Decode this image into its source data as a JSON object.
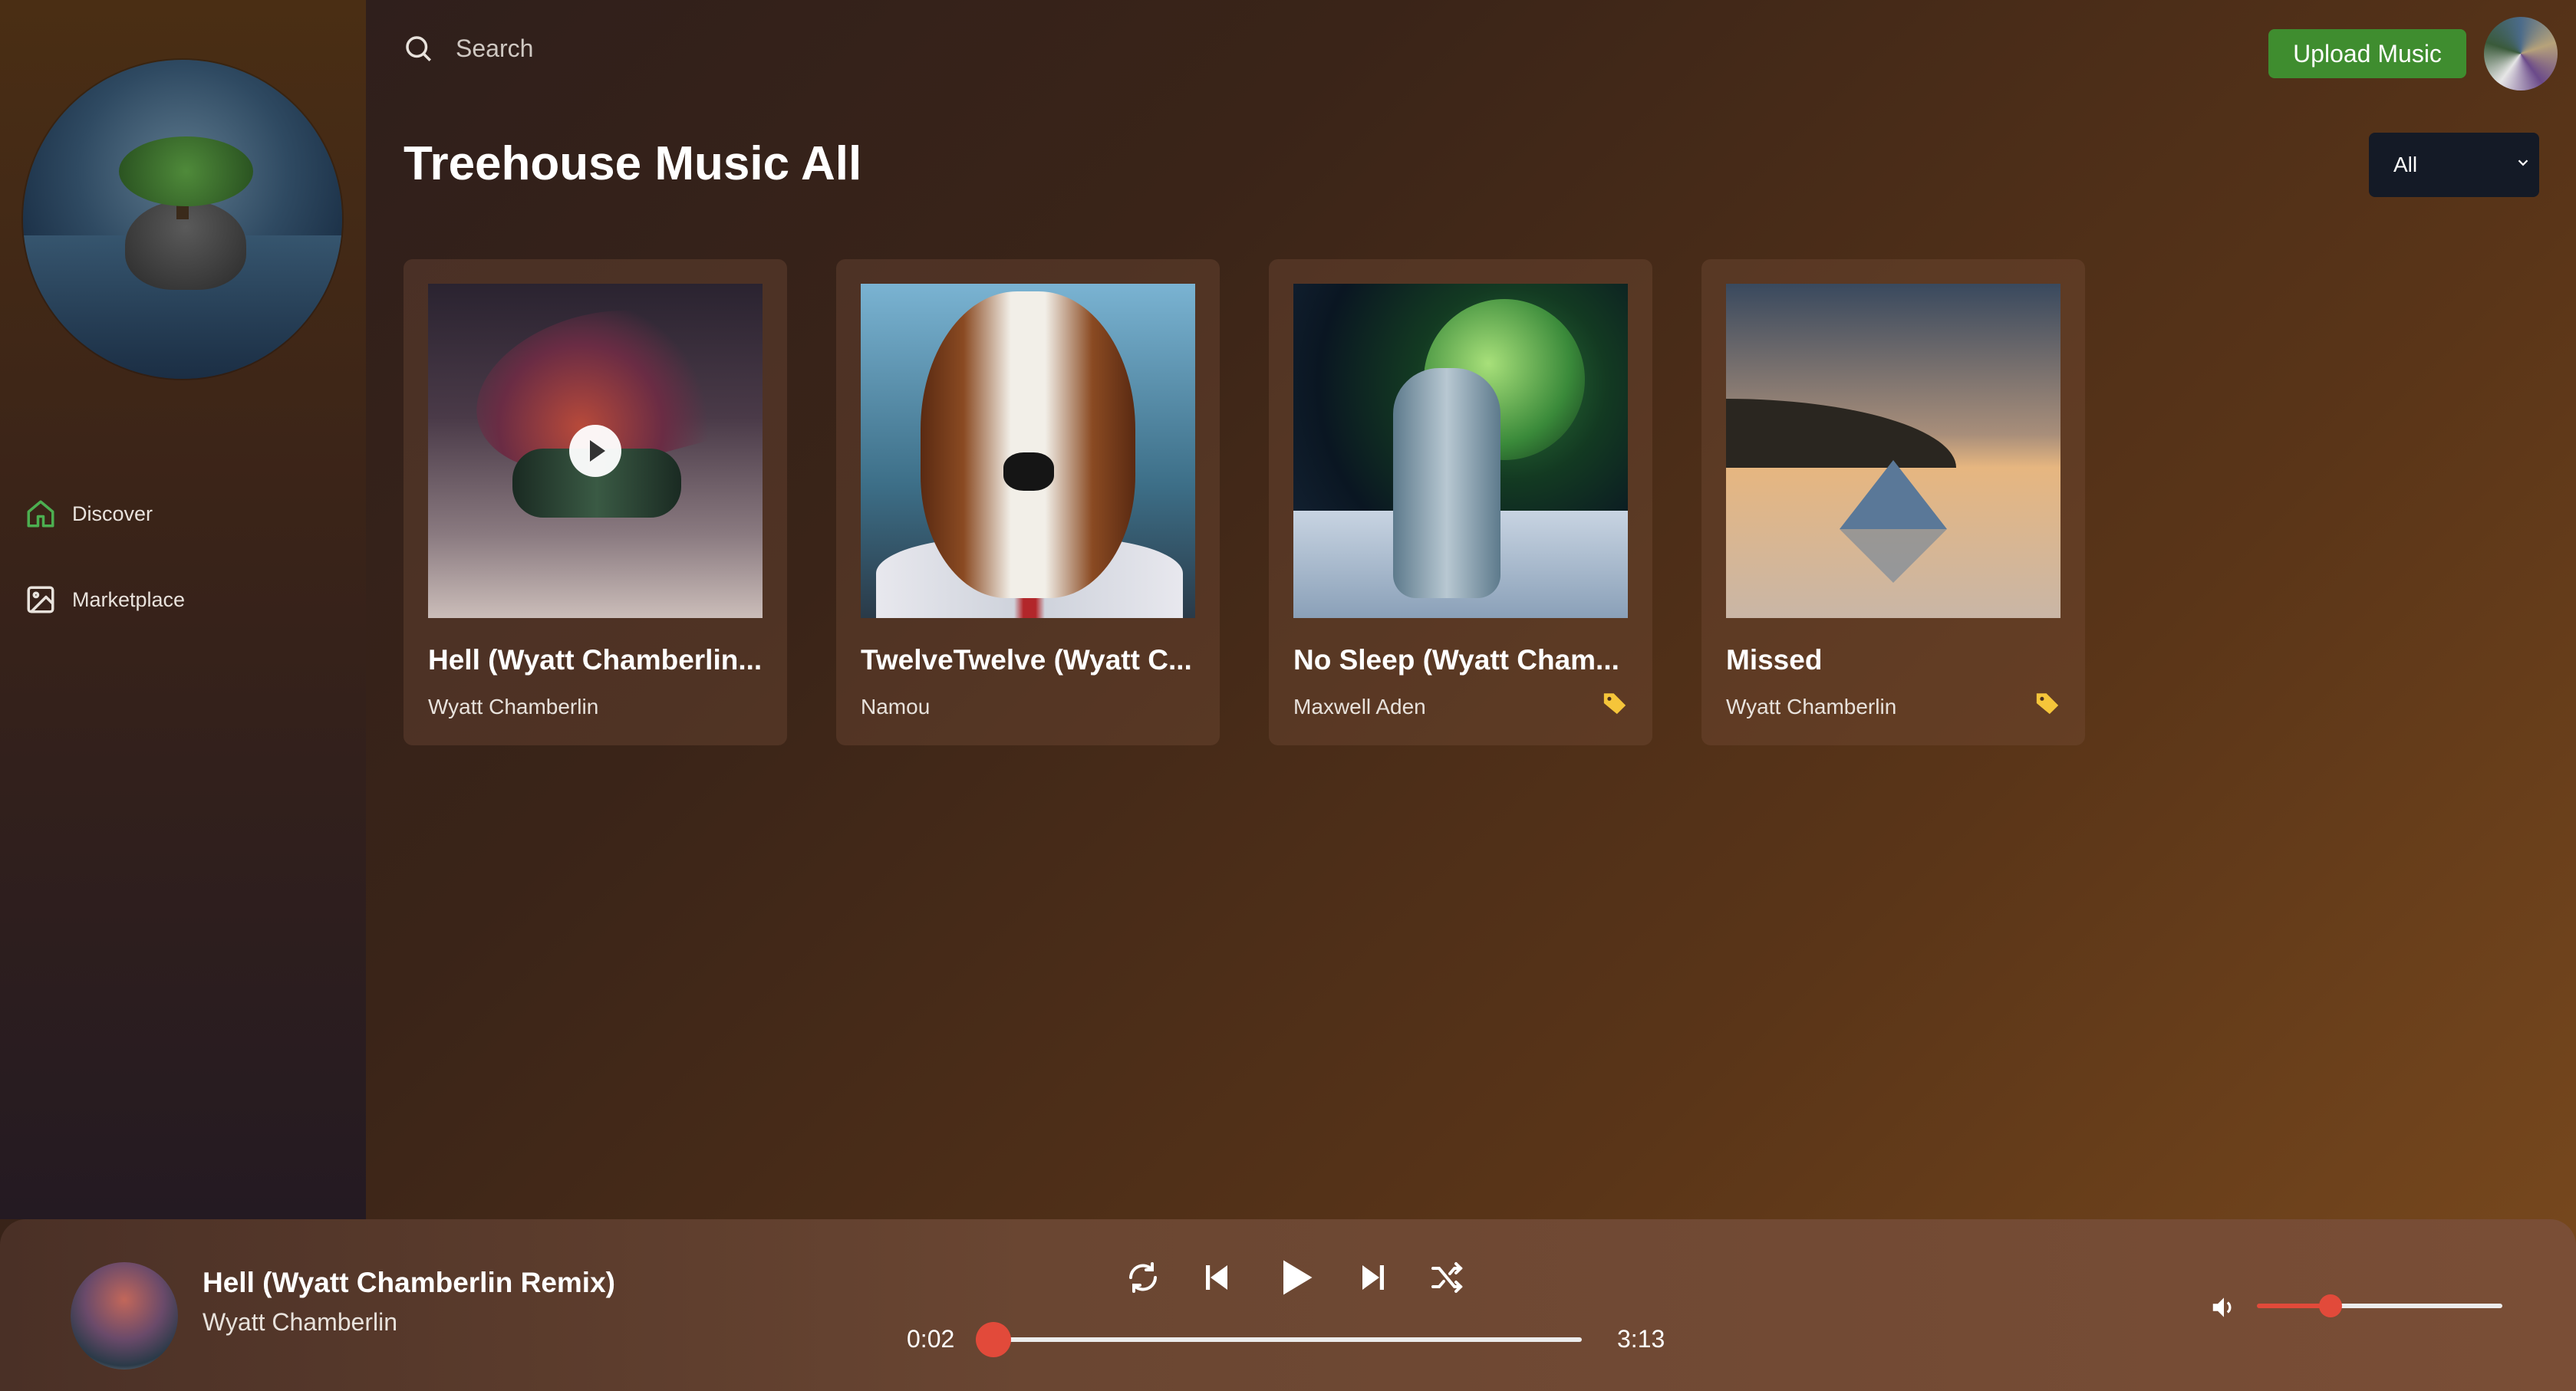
{
  "sidebar": {
    "items": [
      {
        "label": "Discover",
        "icon": "home-icon",
        "active": true
      },
      {
        "label": "Marketplace",
        "icon": "image-icon",
        "active": false
      }
    ]
  },
  "header": {
    "search_placeholder": "Search",
    "upload_label": "Upload Music"
  },
  "main": {
    "title": "Treehouse Music All",
    "filter_value": "All",
    "cards": [
      {
        "title": "Hell (Wyatt Chamberlin...",
        "artist": "Wyatt Chamberlin",
        "tagged": false,
        "playing_hover": true
      },
      {
        "title": "TwelveTwelve (Wyatt C...",
        "artist": "Namou",
        "tagged": false,
        "playing_hover": false
      },
      {
        "title": "No Sleep (Wyatt Cham...",
        "artist": "Maxwell Aden",
        "tagged": true,
        "playing_hover": false
      },
      {
        "title": "Missed",
        "artist": "Wyatt Chamberlin",
        "tagged": true,
        "playing_hover": false
      }
    ]
  },
  "player": {
    "title": "Hell (Wyatt Chamberlin Remix)",
    "artist": "Wyatt Chamberlin",
    "current_time": "0:02",
    "total_time": "3:13",
    "progress": 0.01,
    "volume": 0.3
  },
  "colors": {
    "accent_green": "#3f8d2f",
    "accent_red": "#e24a3a",
    "tag_yellow": "#f5c53a"
  }
}
